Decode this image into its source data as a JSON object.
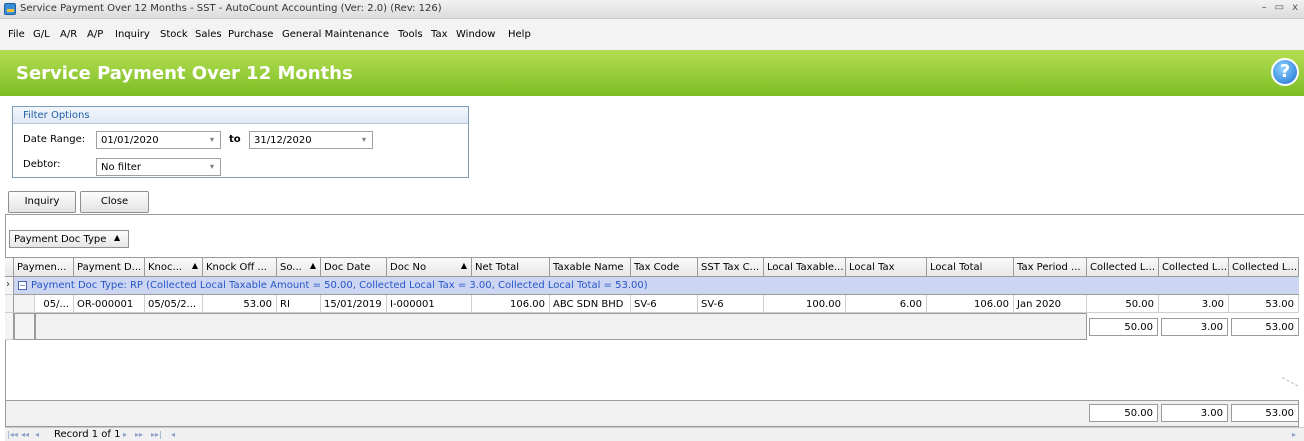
{
  "window": {
    "title": "Service Payment Over 12 Months - SST - AutoCount Accounting (Ver: 2.0) (Rev: 126)",
    "controls": [
      "–",
      "▭",
      "x"
    ]
  },
  "menu": [
    "File",
    "G/L",
    "A/R",
    "A/P",
    "Inquiry",
    "Stock",
    "Sales",
    "Purchase",
    "General Maintenance",
    "Tools",
    "Tax",
    "Window",
    "Help"
  ],
  "header": {
    "title": "Service Payment Over 12 Months",
    "help_glyph": "?"
  },
  "filter": {
    "legend": "Filter Options",
    "date_range_label": "Date Range:",
    "date_from": "01/01/2020",
    "to_label": "to",
    "date_to": "31/12/2020",
    "debtor_label": "Debtor:",
    "debtor_value": "No filter"
  },
  "buttons": {
    "inquiry": "Inquiry",
    "close": "Close"
  },
  "group_panel": {
    "label": "Payment Doc Type",
    "sort": "▲"
  },
  "columns": [
    {
      "label": "Paymen...",
      "sort": ""
    },
    {
      "label": "Payment D...",
      "sort": ""
    },
    {
      "label": "Knoc...",
      "sort": "▲"
    },
    {
      "label": "Knock Off ...",
      "sort": ""
    },
    {
      "label": "So...",
      "sort": "▲"
    },
    {
      "label": "Doc Date",
      "sort": ""
    },
    {
      "label": "Doc No",
      "sort": "▲"
    },
    {
      "label": "Net Total",
      "sort": ""
    },
    {
      "label": "Taxable Name",
      "sort": ""
    },
    {
      "label": "Tax Code",
      "sort": ""
    },
    {
      "label": "SST Tax C...",
      "sort": ""
    },
    {
      "label": "Local Taxable...",
      "sort": ""
    },
    {
      "label": "Local Tax",
      "sort": ""
    },
    {
      "label": "Local Total",
      "sort": ""
    },
    {
      "label": "Tax Period ...",
      "sort": ""
    },
    {
      "label": "Collected L...",
      "sort": ""
    },
    {
      "label": "Collected L...",
      "sort": ""
    },
    {
      "label": "Collected L...",
      "sort": ""
    }
  ],
  "group_row": {
    "expand_glyph": "−",
    "text": "Payment Doc Type: RP (Collected Local Taxable Amount = 50.00, Collected Local Tax = 3.00, Collected Local Total = 53.00)",
    "indicator": "›"
  },
  "rows": [
    [
      "05/...",
      "OR-000001",
      "05/05/2...",
      "53.00",
      "RI",
      "15/01/2019",
      "I-000001",
      "106.00",
      "ABC SDN BHD",
      "SV-6",
      "SV-6",
      "100.00",
      "6.00",
      "106.00",
      "Jan 2020",
      "50.00",
      "3.00",
      "53.00"
    ]
  ],
  "group_summary": [
    "50.00",
    "3.00",
    "53.00"
  ],
  "footer_summary": [
    "50.00",
    "3.00",
    "53.00"
  ],
  "navigator": {
    "record_text": "Record 1 of 1",
    "icons": [
      "|◂◂",
      "◂◂",
      "◂",
      "▸",
      "▸▸",
      "▸▸|",
      "◂",
      "▸"
    ]
  }
}
